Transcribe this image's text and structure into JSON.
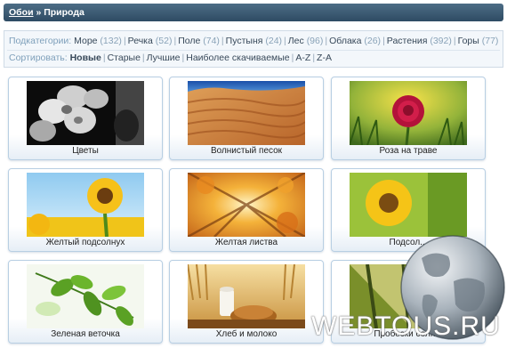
{
  "breadcrumb": {
    "root": "Обои",
    "separator": " » ",
    "current": "Природа"
  },
  "filters": {
    "subcategories_label": "Подкатегории:",
    "subcategories": [
      {
        "name": "Море",
        "count": "(132)"
      },
      {
        "name": "Речка",
        "count": "(52)"
      },
      {
        "name": "Поле",
        "count": "(74)"
      },
      {
        "name": "Пустыня",
        "count": "(24)"
      },
      {
        "name": "Лес",
        "count": "(96)"
      },
      {
        "name": "Облака",
        "count": "(26)"
      },
      {
        "name": "Растения",
        "count": "(392)"
      },
      {
        "name": "Горы",
        "count": "(77)"
      }
    ],
    "sort_label": "Сортировать:",
    "sort_options": [
      "Новые",
      "Старые",
      "Лучшие",
      "Наиболее скачиваемые",
      "A-Z",
      "Z-A"
    ]
  },
  "wallpapers": [
    {
      "title": "Цветы",
      "image": "white-orchids-monochrome"
    },
    {
      "title": "Волнистый песок",
      "image": "sand-dunes"
    },
    {
      "title": "Роза на траве",
      "image": "red-rose-on-grass"
    },
    {
      "title": "Желтый подсолнух",
      "image": "sunflower-blue-sky"
    },
    {
      "title": "Желтая листва",
      "image": "yellow-autumn-foliage"
    },
    {
      "title": "Подсол...",
      "image": "sunflower-closeup"
    },
    {
      "title": "Зеленая веточка",
      "image": "green-twig-leaves"
    },
    {
      "title": "Хлеб и молоко",
      "image": "bread-and-milk"
    },
    {
      "title": "Пробески солн...",
      "image": "sunbeams-forest"
    }
  ],
  "watermark": "WEBTOUS.RU",
  "watermark_logo": "globe-icon"
}
